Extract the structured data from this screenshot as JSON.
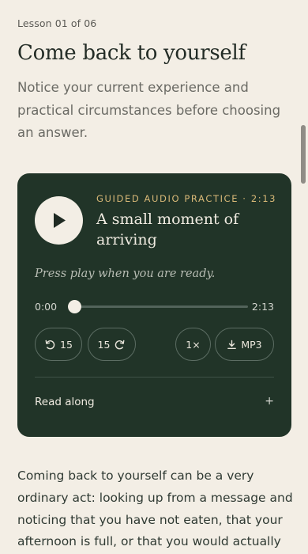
{
  "lesson": {
    "progress_label": "Lesson 01 of 06",
    "title": "Come back to yourself",
    "intro": "Notice your current experience and practical circumstances before choosing an answer."
  },
  "player": {
    "label": "GUIDED AUDIO PRACTICE · 2:13",
    "title": "A small moment of arriving",
    "status": "Press play when you are ready.",
    "current_time": "0:00",
    "total_time": "2:13",
    "progress": 0,
    "rewind_label": "15",
    "forward_label": "15",
    "speed_label": "1×",
    "download_label": "MP3",
    "read_along_label": "Read along",
    "read_along_toggle": "+",
    "icons": {
      "play": "play-icon",
      "rewind": "rewind-15-icon",
      "forward": "forward-15-icon",
      "download": "download-icon"
    }
  },
  "body": {
    "paragraph": "Coming back to yourself can be a very ordinary act: looking up from a message and noticing that you have not eaten, that your afternoon is full, or that you would actually"
  },
  "colors": {
    "background": "#f3eee5",
    "card": "#213428",
    "accent": "#d8b877",
    "text": "#2f3a33"
  }
}
